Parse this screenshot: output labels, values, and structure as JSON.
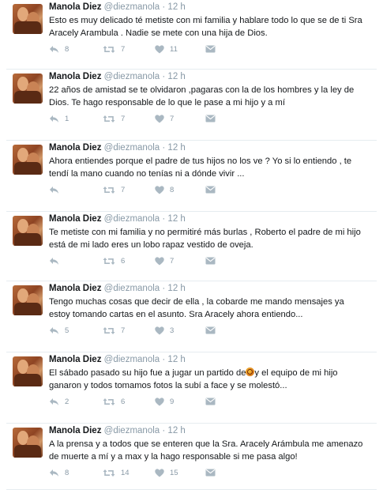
{
  "tweets": [
    {
      "name": "Manola Diez",
      "handle": "@diezmanola",
      "sep": "·",
      "time": "12 h",
      "text1": "Esto es muy delicado té metiste con mi familia y hablare  todo lo que se de ti Sra",
      "text2": "Aracely Arambula . Nadie se mete con una hija de Dios.",
      "replies": "8",
      "retweets": "7",
      "likes": "11"
    },
    {
      "name": "Manola Diez",
      "handle": "@diezmanola",
      "sep": "·",
      "time": "12 h",
      "text1": "22 años de amistad se te olvidaron ,pagaras con la de los hombres y la ley de",
      "text2": "Dios. Te hago responsable de lo que le pase a mi hijo y a mí",
      "replies": "1",
      "retweets": "7",
      "likes": "7"
    },
    {
      "name": "Manola Diez",
      "handle": "@diezmanola",
      "sep": "·",
      "time": "12 h",
      "text1": "Ahora entiendes porque el padre de tus hijos no los ve ? Yo si lo entiendo , te",
      "text2": "tendí la mano cuando no tenías ni a dónde vivir ...",
      "replies": "",
      "retweets": "7",
      "likes": "8"
    },
    {
      "name": "Manola Diez",
      "handle": "@diezmanola",
      "sep": "·",
      "time": "12 h",
      "text1": "Te metiste con mi familia y no permitiré más burlas , Roberto el padre de mi hijo",
      "text2": "está de mi lado eres un lobo rapaz vestido de oveja.",
      "replies": "",
      "retweets": "6",
      "likes": "7"
    },
    {
      "name": "Manola Diez",
      "handle": "@diezmanola",
      "sep": "·",
      "time": "12 h",
      "text1": "Tengo muchas cosas que decir de ella , la cobarde me mando mensajes   ya",
      "text2": "estoy tomando cartas en el asunto. Sra Aracely ahora entiendo...",
      "replies": "5",
      "retweets": "7",
      "likes": "3"
    },
    {
      "name": "Manola Diez",
      "handle": "@diezmanola",
      "sep": "·",
      "time": "12 h",
      "text1a": "El sábado pasado su hijo fue a jugar un partido de",
      "text1b": "y el equipo de mi hijo",
      "text2": "ganaron y todos tomamos fotos la subí a face y se molestó...",
      "replies": "2",
      "retweets": "6",
      "likes": "9"
    },
    {
      "name": "Manola Diez",
      "handle": "@diezmanola",
      "sep": "·",
      "time": "12 h",
      "text1": "A la prensa y a todos que se enteren que la Sra. Aracely Arámbula me amenazo",
      "text2": "de muerte a mí y a max y la hago responsable si me pasa algo!",
      "replies": "8",
      "retweets": "14",
      "likes": "15"
    }
  ],
  "icons": {
    "reply": "reply-icon",
    "retweet": "retweet-icon",
    "like": "heart-icon",
    "dm": "envelope-icon",
    "ball": "basketball-icon"
  },
  "colors": {
    "icon": "#aab8c2",
    "meta": "#8899a6",
    "text": "#14171a",
    "divider": "#e6ecf0"
  }
}
